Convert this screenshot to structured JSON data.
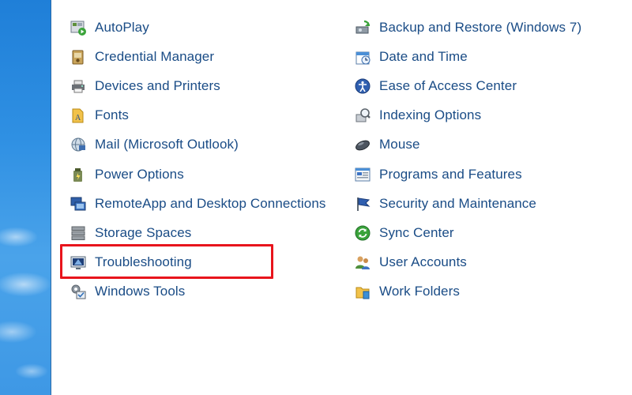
{
  "left_items": [
    {
      "label": "AutoPlay",
      "icon": "autoplay-icon"
    },
    {
      "label": "Credential Manager",
      "icon": "credential-manager-icon"
    },
    {
      "label": "Devices and Printers",
      "icon": "devices-printers-icon"
    },
    {
      "label": "Fonts",
      "icon": "fonts-icon"
    },
    {
      "label": "Mail (Microsoft Outlook)",
      "icon": "mail-icon"
    },
    {
      "label": "Power Options",
      "icon": "power-options-icon"
    },
    {
      "label": "RemoteApp and Desktop Connections",
      "icon": "remoteapp-icon"
    },
    {
      "label": "Storage Spaces",
      "icon": "storage-spaces-icon"
    },
    {
      "label": "Troubleshooting",
      "icon": "troubleshooting-icon"
    },
    {
      "label": "Windows Tools",
      "icon": "windows-tools-icon"
    }
  ],
  "right_items": [
    {
      "label": "Backup and Restore (Windows 7)",
      "icon": "backup-restore-icon"
    },
    {
      "label": "Date and Time",
      "icon": "date-time-icon"
    },
    {
      "label": "Ease of Access Center",
      "icon": "ease-of-access-icon"
    },
    {
      "label": "Indexing Options",
      "icon": "indexing-options-icon"
    },
    {
      "label": "Mouse",
      "icon": "mouse-icon"
    },
    {
      "label": "Programs and Features",
      "icon": "programs-features-icon"
    },
    {
      "label": "Security and Maintenance",
      "icon": "security-maintenance-icon"
    },
    {
      "label": "Sync Center",
      "icon": "sync-center-icon"
    },
    {
      "label": "User Accounts",
      "icon": "user-accounts-icon"
    },
    {
      "label": "Work Folders",
      "icon": "work-folders-icon"
    }
  ],
  "highlighted_item": "Troubleshooting",
  "colors": {
    "link_text": "#1a4c86",
    "highlight_border": "#e8141c",
    "background": "#ffffff"
  }
}
